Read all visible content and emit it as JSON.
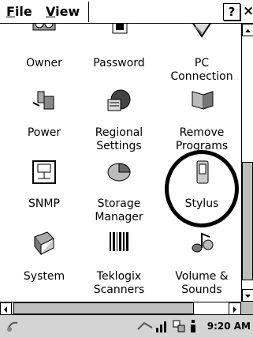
{
  "menubar": {
    "file_label": "File",
    "file_mnemonic": "F",
    "file_rest": "ile",
    "view_mnemonic": "V",
    "view_rest": "iew",
    "help_label": "?",
    "close_label": "×"
  },
  "applets": [
    {
      "label_line1": "Owner",
      "label_line2": "",
      "icon": "owner-icon"
    },
    {
      "label_line1": "Password",
      "label_line2": "",
      "icon": "password-icon"
    },
    {
      "label_line1": "PC",
      "label_line2": "Connection",
      "icon": "pc-connection-icon"
    },
    {
      "label_line1": "Power",
      "label_line2": "",
      "icon": "power-icon"
    },
    {
      "label_line1": "Regional",
      "label_line2": "Settings",
      "icon": "regional-settings-icon"
    },
    {
      "label_line1": "Remove",
      "label_line2": "Programs",
      "icon": "remove-programs-icon"
    },
    {
      "label_line1": "SNMP",
      "label_line2": "",
      "icon": "snmp-icon"
    },
    {
      "label_line1": "Storage",
      "label_line2": "Manager",
      "icon": "storage-manager-icon"
    },
    {
      "label_line1": "Stylus",
      "label_line2": "",
      "icon": "stylus-icon"
    },
    {
      "label_line1": "System",
      "label_line2": "",
      "icon": "system-icon"
    },
    {
      "label_line1": "Teklogix",
      "label_line2": "Scanners",
      "icon": "teklogix-scanners-icon"
    },
    {
      "label_line1": "Volume &",
      "label_line2": "Sounds",
      "icon": "volume-sounds-icon"
    }
  ],
  "taskbar": {
    "time": "9:20 AM"
  },
  "colors": {
    "background": "#ffffff",
    "scroll_thumb": "#bdbdbd",
    "taskbar": "#d4d4d4"
  }
}
